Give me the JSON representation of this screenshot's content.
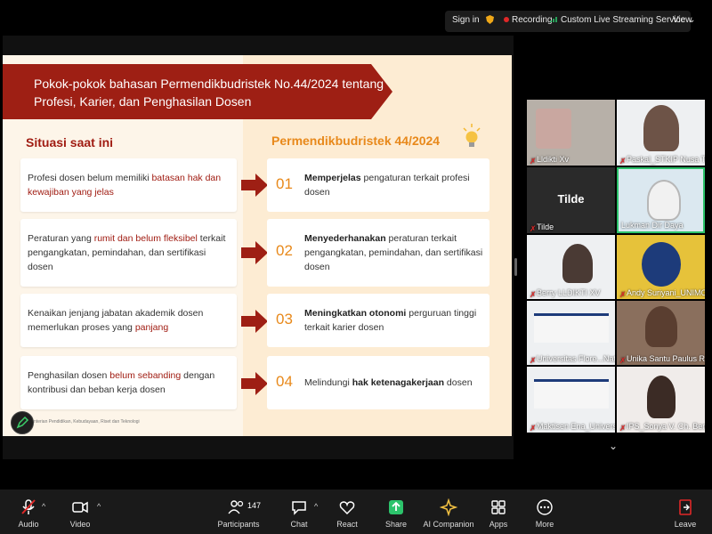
{
  "topbar": {
    "sign_in": "Sign in",
    "recording": "Recording",
    "streaming": "Custom Live Streaming Service",
    "view": "View"
  },
  "slide": {
    "title_line1": "Pokok-pokok bahasan Permendikbudristek No.44/2024 tentang",
    "title_line2": "Profesi, Karier, dan Penghasilan Dosen",
    "left_heading": "Situasi saat ini",
    "right_heading": "Permendikbudristek 44/2024",
    "left_cards": [
      {
        "pre": "Profesi dosen belum memiliki ",
        "hl": "batasan hak dan kewajiban yang jelas",
        "post": ""
      },
      {
        "pre": "Peraturan yang ",
        "hl": "rumit dan belum fleksibel",
        "post": " terkait pengangkatan, pemindahan, dan sertifikasi dosen"
      },
      {
        "pre": "Kenaikan jenjang jabatan akademik dosen memerlukan proses yang ",
        "hl": "panjang",
        "post": ""
      },
      {
        "pre": "Penghasilan dosen ",
        "hl": "belum sebanding",
        "post": " dengan kontribusi dan beban kerja dosen"
      }
    ],
    "right_cards": [
      {
        "num": "01",
        "bold": "Memperjelas",
        "rest": " pengaturan terkait profesi dosen",
        "tail": ""
      },
      {
        "num": "02",
        "bold": "Menyederhanakan",
        "rest": " peraturan terkait pengangkatan, pemindahan, dan sertifikasi dosen",
        "tail": ""
      },
      {
        "num": "03",
        "bold": "Meningkatkan otonomi",
        "rest": " perguruan tinggi terkait karier dosen",
        "tail": ""
      },
      {
        "num": "04",
        "bold": "hak ketenagakerjaan",
        "rest": "Melindungi ",
        "tail": " dosen"
      }
    ],
    "footer": "Kementerian Pendidikan, Kebudayaan, Riset dan Teknologi"
  },
  "participants": [
    {
      "name": "Lldikti Xv",
      "muted": true
    },
    {
      "name": "Paskal_STKIP Nusa Tim...",
      "muted": true
    },
    {
      "name": "Tilde",
      "muted": true,
      "initials": "Tilde"
    },
    {
      "name": "Lukman Dir Daya",
      "muted": false
    },
    {
      "name": "Berry LLDIKTI XV",
      "muted": true
    },
    {
      "name": "Andy Suriyani_UNIMOF",
      "muted": true
    },
    {
      "name": "Universitas Flore...Nat...",
      "muted": true
    },
    {
      "name": "Unika Santu Paulus Ru...",
      "muted": true
    },
    {
      "name": "Maktisen Ena_Universi...",
      "muted": true
    },
    {
      "name": "IPS_Sonya V. Ch. Benu",
      "muted": true
    }
  ],
  "toolbar": {
    "audio": "Audio",
    "video": "Video",
    "participants": "Participants",
    "participants_count": "147",
    "chat": "Chat",
    "react": "React",
    "share": "Share",
    "ai_companion": "AI Companion",
    "apps": "Apps",
    "more": "More",
    "leave": "Leave"
  },
  "colors": {
    "banner": "#9e1f14",
    "accent_orange": "#e8891b",
    "highlight_red": "#a01c12",
    "share_green": "#2cc36b",
    "leave_red": "#e02828"
  }
}
